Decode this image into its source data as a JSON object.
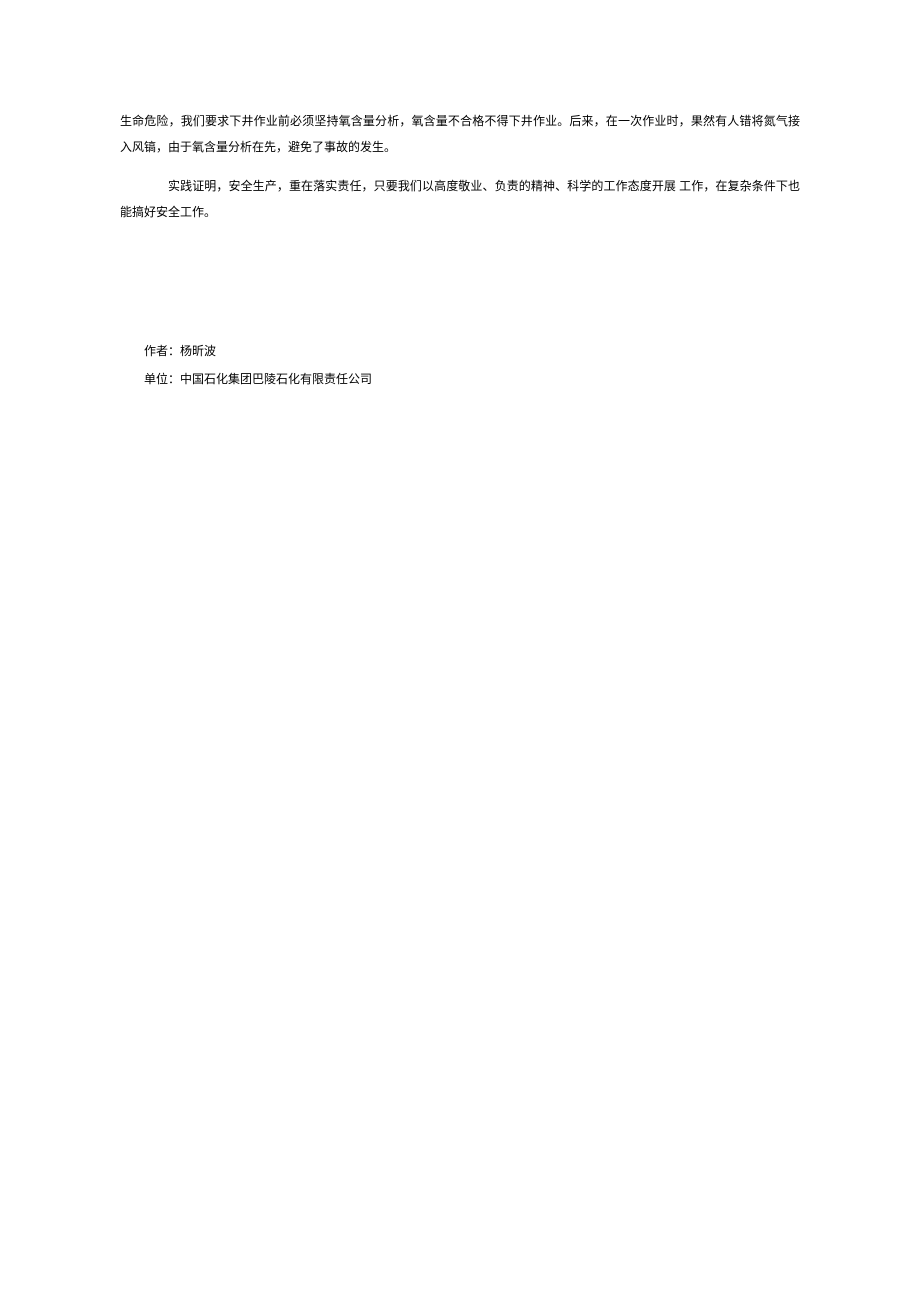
{
  "body": {
    "paragraph1": "生命危险，我们要求下井作业前必须坚持氧含量分析，氧含量不合格不得下井作业。后来，在一次作业时，果然有人错将氮气接入风镐，由于氧含量分析在先，避免了事故的发生。",
    "paragraph2": "实践证明，安全生产，重在落实责任，只要我们以高度敬业、负责的精神、科学的工作态度开展 工作，在复杂条件下也能搞好安全工作。"
  },
  "meta": {
    "author_label": "作者：",
    "author_name": "杨昕波",
    "unit_label": "单位：",
    "unit_name": "中国石化集团巴陵石化有限责任公司"
  }
}
